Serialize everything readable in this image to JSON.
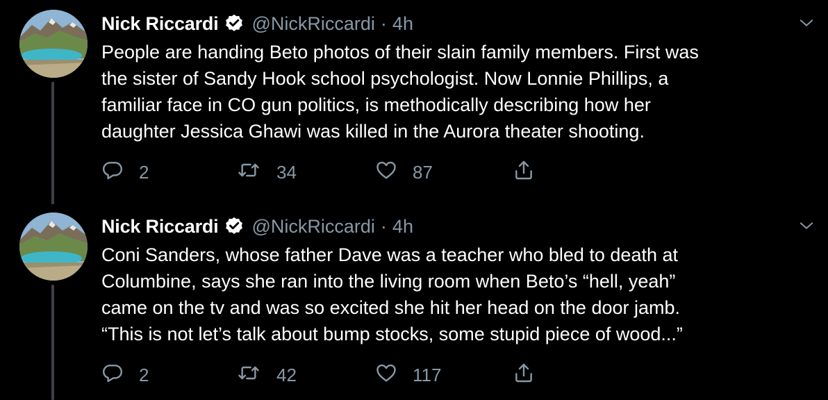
{
  "colors": {
    "background": "#000000",
    "text": "#ffffff",
    "muted": "#8899a6",
    "thread_line": "#3d4145"
  },
  "tweets": [
    {
      "author_name": "Nick Riccardi",
      "verified": true,
      "handle": "@NickRiccardi",
      "separator": "·",
      "time": "4h",
      "text_lines": [
        "People are handing Beto photos of their slain family members. First was",
        "the sister of Sandy Hook school psychologist. Now Lonnie Phillips, a",
        "familiar face in CO gun politics, is methodically describing how her",
        "daughter Jessica Ghawi was killed in the Aurora theater shooting."
      ],
      "replies": "2",
      "retweets": "34",
      "likes": "87",
      "icons": {
        "reply": "reply-icon",
        "retweet": "retweet-icon",
        "like": "heart-icon",
        "share": "share-icon",
        "menu": "chevron-down-icon"
      }
    },
    {
      "author_name": "Nick Riccardi",
      "verified": true,
      "handle": "@NickRiccardi",
      "separator": "·",
      "time": "4h",
      "text_lines": [
        "Coni Sanders, whose father Dave was a teacher who bled to death at",
        "Columbine, says she ran into the living room when Beto’s “hell, yeah”",
        "came on the tv and was so excited she hit her head on the door jamb.",
        "“This is not let’s talk about bump stocks, some stupid piece of wood...”"
      ],
      "replies": "2",
      "retweets": "42",
      "likes": "117",
      "icons": {
        "reply": "reply-icon",
        "retweet": "retweet-icon",
        "like": "heart-icon",
        "share": "share-icon",
        "menu": "chevron-down-icon"
      }
    }
  ]
}
